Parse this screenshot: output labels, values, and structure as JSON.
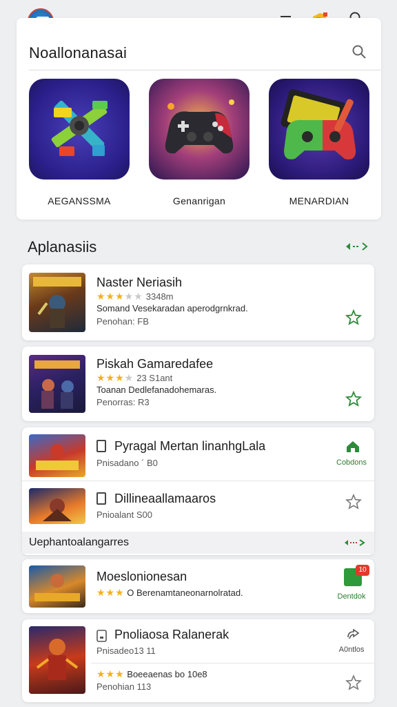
{
  "header": {
    "title": "Noallonanasai",
    "logo_icon": "app-logo-icon",
    "menu_icon": "menu-icon",
    "promo_icon": "promo-hand-icon",
    "search_icon": "search-icon"
  },
  "categories": [
    {
      "label": "AEGANSSMA",
      "icon": "joystick-cross-icon"
    },
    {
      "label": "Genanrigan",
      "icon": "gamepad-icon"
    },
    {
      "label": "MENARDIAN",
      "icon": "green-gamepad-icon"
    }
  ],
  "section": {
    "title": "Aplanasiis",
    "more": "→"
  },
  "apps": [
    {
      "title": "Naster Neriasih",
      "rating_text": "3348m",
      "rating": 3,
      "desc": "Somand Vesekaradan aperodgrnkrad.",
      "sub": "Penohan: FB"
    },
    {
      "title": "Piskah Gamaredafee",
      "rating_text": "23  S1ant",
      "rating": 3,
      "desc": "Toanan Dedlefanadohemaras.",
      "sub": "Penorras: R3"
    }
  ],
  "list_items": [
    {
      "title": "Pyragal Mertan linanhgLala",
      "sub": "Pnisadano ´ B0",
      "action": "Cobdons"
    },
    {
      "title": "Dillineaallamaaros",
      "sub": "Pnioalant S00"
    }
  ],
  "subsection": {
    "title": "Uephantoalangarres"
  },
  "bottom_apps": [
    {
      "title": "Moeslonionesan",
      "rating": 3,
      "desc": "O Berenamtaneonarnolratad.",
      "action": "Dentdok",
      "badge": "10"
    },
    {
      "title": "Pnoliaosa Ralanerak",
      "sub": "Pnisadeo13 11",
      "action": "A0ntlos",
      "rating": 3,
      "desc": "Boeeaenas bo 10e8",
      "sub2": "Penohian 113"
    }
  ],
  "colors": {
    "accent": "#2e8b3a",
    "star": "#f2b01e",
    "background": "#eeeff1"
  }
}
